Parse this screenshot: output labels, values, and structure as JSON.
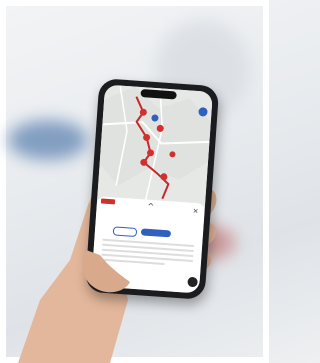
{
  "scene": {
    "description_text": "",
    "background": {
      "colors": {
        "frame": "#ffffff",
        "blue_blur": "#2c5d9a",
        "red_blur": "#b95a58"
      }
    }
  },
  "phone": {
    "status_bar": {
      "time": "",
      "icons": ""
    },
    "map": {
      "route_color": "#c62828",
      "marker_color": "#d32f2f",
      "badge_color": "#2f5fbf"
    },
    "sheet": {
      "title": "",
      "stats": "",
      "button_primary": "",
      "button_secondary": ""
    }
  }
}
